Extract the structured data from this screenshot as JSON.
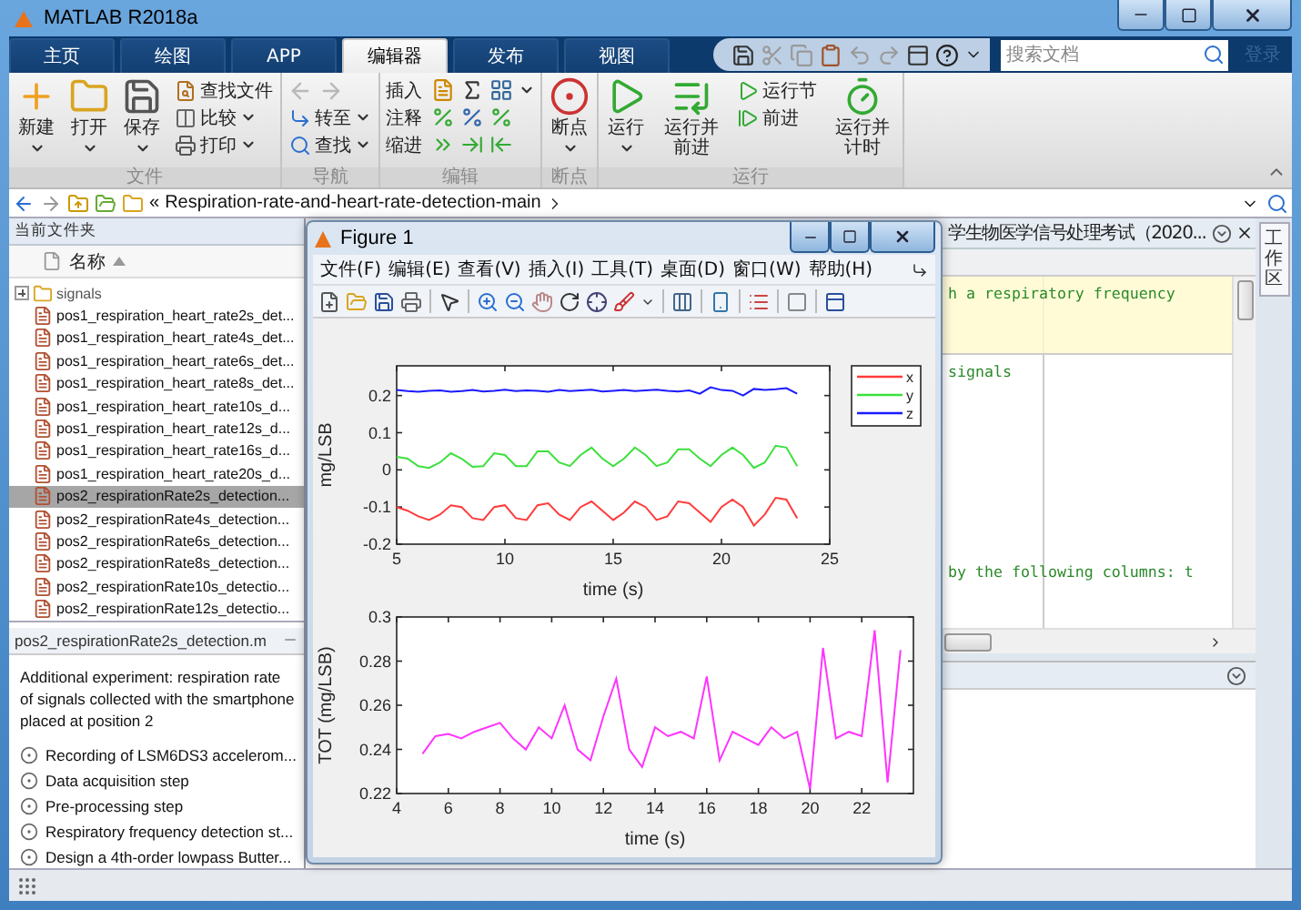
{
  "window": {
    "title": "MATLAB R2018a"
  },
  "tabs": [
    {
      "label": "主页",
      "selected": false
    },
    {
      "label": "绘图",
      "selected": false
    },
    {
      "label": "APP",
      "selected": false
    },
    {
      "label": "编辑器",
      "selected": true
    },
    {
      "label": "发布",
      "selected": false
    },
    {
      "label": "视图",
      "selected": false
    }
  ],
  "search": {
    "placeholder": "搜索文档"
  },
  "login": "登录",
  "ribbon": [
    {
      "label": "文件",
      "columns": [
        {
          "kind": "large",
          "label": "新建",
          "caret": true
        },
        {
          "kind": "large",
          "label": "打开",
          "caret": true
        },
        {
          "kind": "large",
          "label": "保存",
          "caret": true
        },
        {
          "kind": "stack",
          "rows": [
            {
              "kind": "button",
              "label": "查找文件",
              "caret": false
            },
            {
              "kind": "button",
              "label": "比较",
              "caret": true
            },
            {
              "kind": "button",
              "label": "打印",
              "caret": true
            }
          ]
        }
      ]
    },
    {
      "label": "导航",
      "columns": [
        {
          "kind": "stack",
          "rows": [
            {
              "kind": "arrows",
              "disabled": true
            },
            {
              "kind": "button",
              "label": "转至",
              "caret": true
            },
            {
              "kind": "button",
              "label": "查找",
              "caret": true
            }
          ]
        }
      ]
    },
    {
      "label": "编辑",
      "columns": [
        {
          "kind": "stack",
          "rows": [
            {
              "kind": "tools",
              "label": "插入",
              "caret": true
            },
            {
              "kind": "tools",
              "label": "注释",
              "caret": false
            },
            {
              "kind": "tools",
              "label": "缩进",
              "caret": false
            }
          ]
        }
      ]
    },
    {
      "label": "断点",
      "columns": [
        {
          "kind": "large",
          "label": "断点",
          "caret": true
        }
      ]
    },
    {
      "label": "运行",
      "columns": [
        {
          "kind": "large",
          "label": "运行",
          "caret": true
        },
        {
          "kind": "large",
          "label": "运行并前进",
          "caret": false
        },
        {
          "kind": "stack",
          "rows": [
            {
              "kind": "button",
              "label": "运行节",
              "caret": false
            },
            {
              "kind": "button",
              "label": "前进",
              "caret": false
            }
          ]
        },
        {
          "kind": "large",
          "label": "运行并计时",
          "caret": false
        }
      ]
    }
  ],
  "address": {
    "prefix": "«",
    "path": "Respiration-rate-and-heart-rate-detection-main"
  },
  "current_folder": {
    "title": "当前文件夹",
    "column": "名称",
    "items": [
      {
        "kind": "folder",
        "name": "signals",
        "expanded": false,
        "selected": false
      },
      {
        "kind": "file",
        "name": "pos1_respiration_heart_rate2s_det...",
        "selected": false
      },
      {
        "kind": "file",
        "name": "pos1_respiration_heart_rate4s_det...",
        "selected": false
      },
      {
        "kind": "file",
        "name": "pos1_respiration_heart_rate6s_det...",
        "selected": false
      },
      {
        "kind": "file",
        "name": "pos1_respiration_heart_rate8s_det...",
        "selected": false
      },
      {
        "kind": "file",
        "name": "pos1_respiration_heart_rate10s_d...",
        "selected": false
      },
      {
        "kind": "file",
        "name": "pos1_respiration_heart_rate12s_d...",
        "selected": false
      },
      {
        "kind": "file",
        "name": "pos1_respiration_heart_rate16s_d...",
        "selected": false
      },
      {
        "kind": "file",
        "name": "pos1_respiration_heart_rate20s_d...",
        "selected": false
      },
      {
        "kind": "file",
        "name": "pos2_respirationRate2s_detection...",
        "selected": true
      },
      {
        "kind": "file",
        "name": "pos2_respirationRate4s_detection...",
        "selected": false
      },
      {
        "kind": "file",
        "name": "pos2_respirationRate6s_detection...",
        "selected": false
      },
      {
        "kind": "file",
        "name": "pos2_respirationRate8s_detection...",
        "selected": false
      },
      {
        "kind": "file",
        "name": "pos2_respirationRate10s_detectio...",
        "selected": false
      },
      {
        "kind": "file",
        "name": "pos2_respirationRate12s_detectio...",
        "selected": false
      }
    ]
  },
  "details": {
    "title": "pos2_respirationRate2s_detection.m",
    "description": "Additional experiment: respiration rate of signals collected with the smartphone placed at position 2",
    "sections": [
      "Recording of LSM6DS3 accelerom...",
      "Data acquisition step",
      "Pre-processing step",
      "Respiratory frequency detection st...",
      "Design a 4th-order lowpass Butter..."
    ]
  },
  "editor": {
    "tab_title": "学生物医学信号处理考试（2020...",
    "sections": [
      {
        "highlighted": true,
        "lines": [
          "h a respiratory frequency"
        ]
      },
      {
        "highlighted": false,
        "lines": [
          "signals",
          "by the following columns: t"
        ]
      }
    ]
  },
  "side_tab": "工作区",
  "figure": {
    "title": "Figure 1",
    "menu": [
      "文件(F)",
      "编辑(E)",
      "查看(V)",
      "插入(I)",
      "工具(T)",
      "桌面(D)",
      "窗口(W)",
      "帮助(H)"
    ],
    "axes": [
      {
        "chart_data": {
          "type": "line",
          "xlabel": "time (s)",
          "ylabel": "mg/LSB",
          "x": [
            5,
            5.5,
            6,
            6.5,
            7,
            7.5,
            8,
            8.5,
            9,
            9.5,
            10,
            10.5,
            11,
            11.5,
            12,
            12.5,
            13,
            13.5,
            14,
            14.5,
            15,
            15.5,
            16,
            16.5,
            17,
            17.5,
            18,
            18.5,
            19,
            19.5,
            20,
            20.5,
            21,
            21.5,
            22,
            22.5,
            23,
            23.5
          ],
          "series": [
            {
              "name": "x",
              "color": "#ff3b3b",
              "values": [
                -0.1,
                -0.11,
                -0.125,
                -0.135,
                -0.12,
                -0.095,
                -0.1,
                -0.13,
                -0.135,
                -0.1,
                -0.095,
                -0.13,
                -0.135,
                -0.095,
                -0.09,
                -0.12,
                -0.135,
                -0.1,
                -0.085,
                -0.11,
                -0.135,
                -0.115,
                -0.085,
                -0.1,
                -0.135,
                -0.125,
                -0.085,
                -0.09,
                -0.115,
                -0.14,
                -0.1,
                -0.08,
                -0.1,
                -0.15,
                -0.12,
                -0.075,
                -0.08,
                -0.13
              ]
            },
            {
              "name": "y",
              "color": "#3ce03c",
              "values": [
                0.035,
                0.03,
                0.01,
                0.005,
                0.02,
                0.045,
                0.03,
                0.008,
                0.01,
                0.045,
                0.04,
                0.01,
                0.01,
                0.05,
                0.05,
                0.02,
                0.01,
                0.04,
                0.06,
                0.03,
                0.01,
                0.03,
                0.06,
                0.04,
                0.01,
                0.02,
                0.055,
                0.055,
                0.03,
                0.01,
                0.04,
                0.06,
                0.04,
                0.005,
                0.02,
                0.065,
                0.06,
                0.01
              ]
            },
            {
              "name": "z",
              "color": "#1a1aff",
              "values": [
                0.215,
                0.212,
                0.21,
                0.213,
                0.214,
                0.21,
                0.212,
                0.215,
                0.211,
                0.213,
                0.216,
                0.212,
                0.214,
                0.213,
                0.21,
                0.215,
                0.212,
                0.214,
                0.216,
                0.211,
                0.213,
                0.215,
                0.212,
                0.214,
                0.216,
                0.213,
                0.211,
                0.214,
                0.205,
                0.222,
                0.215,
                0.213,
                0.2,
                0.218,
                0.215,
                0.217,
                0.22,
                0.205
              ]
            }
          ],
          "legend": true,
          "xlim": [
            5,
            25
          ],
          "ylim": [
            -0.2,
            0.28
          ],
          "xticks": [
            5,
            10,
            15,
            20,
            25
          ],
          "yticks": [
            -0.2,
            -0.1,
            0,
            0.1,
            0.2
          ]
        }
      },
      {
        "chart_data": {
          "type": "line",
          "xlabel": "time (s)",
          "ylabel": "TOT (mg/LSB)",
          "x": [
            5,
            5.5,
            6,
            6.5,
            7,
            7.5,
            8,
            8.5,
            9,
            9.5,
            10,
            10.5,
            11,
            11.5,
            12,
            12.5,
            13,
            13.5,
            14,
            14.5,
            15,
            15.5,
            16,
            16.5,
            17,
            17.5,
            18,
            18.5,
            19,
            19.5,
            20,
            20.5,
            21,
            21.5,
            22,
            22.5,
            23,
            23.5
          ],
          "series": [
            {
              "color": "#ff33ff",
              "values": [
                0.238,
                0.246,
                0.247,
                0.245,
                0.248,
                0.25,
                0.252,
                0.245,
                0.24,
                0.25,
                0.245,
                0.26,
                0.24,
                0.235,
                0.255,
                0.272,
                0.24,
                0.232,
                0.25,
                0.246,
                0.248,
                0.245,
                0.273,
                0.235,
                0.248,
                0.245,
                0.242,
                0.25,
                0.245,
                0.248,
                0.222,
                0.286,
                0.245,
                0.248,
                0.246,
                0.294,
                0.225,
                0.285
              ]
            }
          ],
          "xlim": [
            4,
            24
          ],
          "ylim": [
            0.22,
            0.3
          ],
          "xticks": [
            4,
            6,
            8,
            10,
            12,
            14,
            16,
            18,
            20,
            22
          ],
          "yticks": [
            0.22,
            0.24,
            0.26,
            0.28,
            0.3
          ]
        }
      }
    ]
  }
}
